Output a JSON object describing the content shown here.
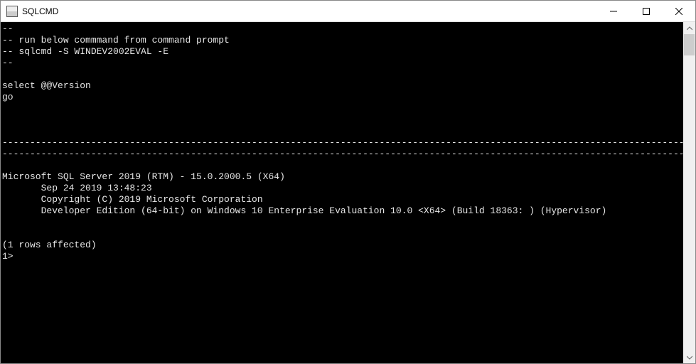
{
  "window": {
    "title": "SQLCMD"
  },
  "console": {
    "lines": [
      "--",
      "-- run below commmand from command prompt",
      "-- sqlcmd -S WINDEV2002EVAL -E",
      "--",
      "",
      "select @@Version",
      "go",
      "",
      "",
      "",
      "-------------------------------------------------------------------------------------------------------------------------------------------",
      "-------------------------------------------------------------------------------------------------------------------------------------------",
      "",
      "Microsoft SQL Server 2019 (RTM) - 15.0.2000.5 (X64)",
      "       Sep 24 2019 13:48:23",
      "       Copyright (C) 2019 Microsoft Corporation",
      "       Developer Edition (64-bit) on Windows 10 Enterprise Evaluation 10.0 <X64> (Build 18363: ) (Hypervisor)",
      "",
      "",
      "(1 rows affected)",
      "1>"
    ]
  }
}
